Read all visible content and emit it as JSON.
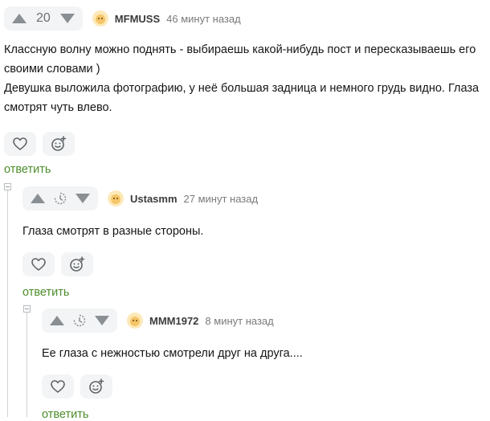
{
  "comments": [
    {
      "rating": "20",
      "author": "MFMUSS",
      "time": "46 минут назад",
      "lines": [
        "Классную волну можно поднять - выбираешь какой-нибудь пост и пересказываешь его",
        "своими словами )",
        "Девушка выложила фотографию, у неё большая задница и немного грудь видно. Глаза",
        "смотрят чуть влево."
      ],
      "reply_label": "ответить"
    },
    {
      "author": "Ustasmm",
      "time": "27 минут назад",
      "lines": [
        "Глаза смотрят в разные стороны."
      ],
      "reply_label": "ответить"
    },
    {
      "author": "MMM1972",
      "time": "8 минут назад",
      "lines": [
        "Ее глаза с нежностью смотрели друг на друга...."
      ],
      "reply_label": "ответить"
    }
  ],
  "colors": {
    "accent_reply": "#4c8c2a",
    "button_bg": "#f3f4f5",
    "icon": "#8a8f94"
  }
}
